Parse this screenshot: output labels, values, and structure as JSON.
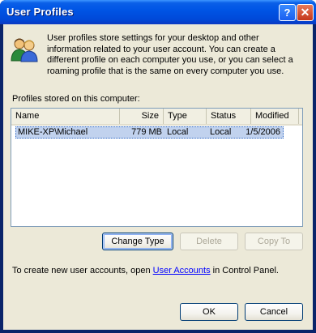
{
  "window": {
    "title": "User Profiles",
    "help_button": "?",
    "close_button": "✕"
  },
  "intro_text": "User profiles store settings for your desktop and other information related to your user account. You can create a different profile on each computer you use, or you can select a roaming profile that is the same on every computer you use.",
  "profiles": {
    "group_label": "Profiles stored on this computer:",
    "columns": [
      "Name",
      "Size",
      "Type",
      "Status",
      "Modified"
    ],
    "rows": [
      {
        "name": "MIKE-XP\\Michael",
        "size": "779 MB",
        "type": "Local",
        "status": "Local",
        "modified": "1/5/2006"
      }
    ]
  },
  "buttons": {
    "change_type": "Change Type",
    "delete": "Delete",
    "copy_to": "Copy To",
    "ok": "OK",
    "cancel": "Cancel"
  },
  "footer": {
    "prefix": "To create new user accounts, open ",
    "link": "User Accounts",
    "suffix": " in Control Panel."
  },
  "colors": {
    "titlebar": "#0055e5",
    "selection": "#c1d2ee",
    "link": "#0000ff"
  }
}
